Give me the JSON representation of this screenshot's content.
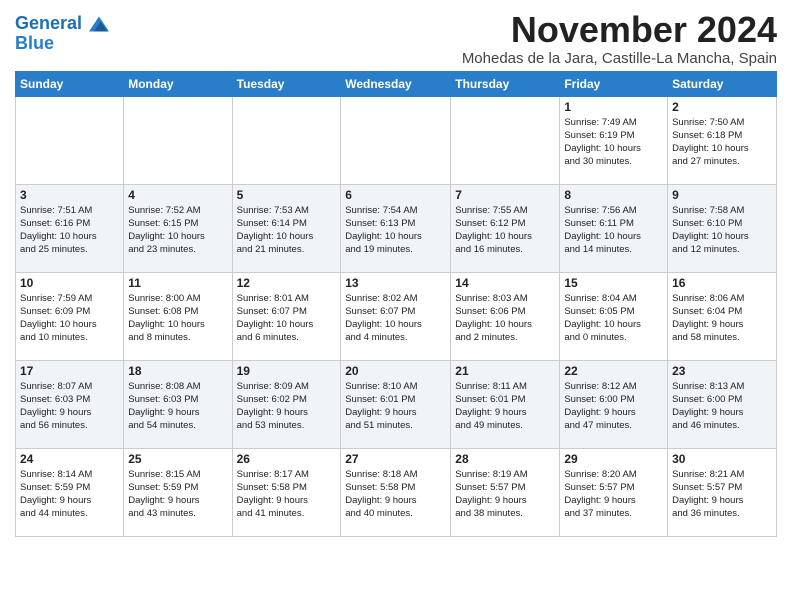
{
  "header": {
    "logo_line1": "General",
    "logo_line2": "Blue",
    "month": "November 2024",
    "location": "Mohedas de la Jara, Castille-La Mancha, Spain"
  },
  "weekdays": [
    "Sunday",
    "Monday",
    "Tuesday",
    "Wednesday",
    "Thursday",
    "Friday",
    "Saturday"
  ],
  "weeks": [
    [
      {
        "day": "",
        "info": ""
      },
      {
        "day": "",
        "info": ""
      },
      {
        "day": "",
        "info": ""
      },
      {
        "day": "",
        "info": ""
      },
      {
        "day": "",
        "info": ""
      },
      {
        "day": "1",
        "info": "Sunrise: 7:49 AM\nSunset: 6:19 PM\nDaylight: 10 hours\nand 30 minutes."
      },
      {
        "day": "2",
        "info": "Sunrise: 7:50 AM\nSunset: 6:18 PM\nDaylight: 10 hours\nand 27 minutes."
      }
    ],
    [
      {
        "day": "3",
        "info": "Sunrise: 7:51 AM\nSunset: 6:16 PM\nDaylight: 10 hours\nand 25 minutes."
      },
      {
        "day": "4",
        "info": "Sunrise: 7:52 AM\nSunset: 6:15 PM\nDaylight: 10 hours\nand 23 minutes."
      },
      {
        "day": "5",
        "info": "Sunrise: 7:53 AM\nSunset: 6:14 PM\nDaylight: 10 hours\nand 21 minutes."
      },
      {
        "day": "6",
        "info": "Sunrise: 7:54 AM\nSunset: 6:13 PM\nDaylight: 10 hours\nand 19 minutes."
      },
      {
        "day": "7",
        "info": "Sunrise: 7:55 AM\nSunset: 6:12 PM\nDaylight: 10 hours\nand 16 minutes."
      },
      {
        "day": "8",
        "info": "Sunrise: 7:56 AM\nSunset: 6:11 PM\nDaylight: 10 hours\nand 14 minutes."
      },
      {
        "day": "9",
        "info": "Sunrise: 7:58 AM\nSunset: 6:10 PM\nDaylight: 10 hours\nand 12 minutes."
      }
    ],
    [
      {
        "day": "10",
        "info": "Sunrise: 7:59 AM\nSunset: 6:09 PM\nDaylight: 10 hours\nand 10 minutes."
      },
      {
        "day": "11",
        "info": "Sunrise: 8:00 AM\nSunset: 6:08 PM\nDaylight: 10 hours\nand 8 minutes."
      },
      {
        "day": "12",
        "info": "Sunrise: 8:01 AM\nSunset: 6:07 PM\nDaylight: 10 hours\nand 6 minutes."
      },
      {
        "day": "13",
        "info": "Sunrise: 8:02 AM\nSunset: 6:07 PM\nDaylight: 10 hours\nand 4 minutes."
      },
      {
        "day": "14",
        "info": "Sunrise: 8:03 AM\nSunset: 6:06 PM\nDaylight: 10 hours\nand 2 minutes."
      },
      {
        "day": "15",
        "info": "Sunrise: 8:04 AM\nSunset: 6:05 PM\nDaylight: 10 hours\nand 0 minutes."
      },
      {
        "day": "16",
        "info": "Sunrise: 8:06 AM\nSunset: 6:04 PM\nDaylight: 9 hours\nand 58 minutes."
      }
    ],
    [
      {
        "day": "17",
        "info": "Sunrise: 8:07 AM\nSunset: 6:03 PM\nDaylight: 9 hours\nand 56 minutes."
      },
      {
        "day": "18",
        "info": "Sunrise: 8:08 AM\nSunset: 6:03 PM\nDaylight: 9 hours\nand 54 minutes."
      },
      {
        "day": "19",
        "info": "Sunrise: 8:09 AM\nSunset: 6:02 PM\nDaylight: 9 hours\nand 53 minutes."
      },
      {
        "day": "20",
        "info": "Sunrise: 8:10 AM\nSunset: 6:01 PM\nDaylight: 9 hours\nand 51 minutes."
      },
      {
        "day": "21",
        "info": "Sunrise: 8:11 AM\nSunset: 6:01 PM\nDaylight: 9 hours\nand 49 minutes."
      },
      {
        "day": "22",
        "info": "Sunrise: 8:12 AM\nSunset: 6:00 PM\nDaylight: 9 hours\nand 47 minutes."
      },
      {
        "day": "23",
        "info": "Sunrise: 8:13 AM\nSunset: 6:00 PM\nDaylight: 9 hours\nand 46 minutes."
      }
    ],
    [
      {
        "day": "24",
        "info": "Sunrise: 8:14 AM\nSunset: 5:59 PM\nDaylight: 9 hours\nand 44 minutes."
      },
      {
        "day": "25",
        "info": "Sunrise: 8:15 AM\nSunset: 5:59 PM\nDaylight: 9 hours\nand 43 minutes."
      },
      {
        "day": "26",
        "info": "Sunrise: 8:17 AM\nSunset: 5:58 PM\nDaylight: 9 hours\nand 41 minutes."
      },
      {
        "day": "27",
        "info": "Sunrise: 8:18 AM\nSunset: 5:58 PM\nDaylight: 9 hours\nand 40 minutes."
      },
      {
        "day": "28",
        "info": "Sunrise: 8:19 AM\nSunset: 5:57 PM\nDaylight: 9 hours\nand 38 minutes."
      },
      {
        "day": "29",
        "info": "Sunrise: 8:20 AM\nSunset: 5:57 PM\nDaylight: 9 hours\nand 37 minutes."
      },
      {
        "day": "30",
        "info": "Sunrise: 8:21 AM\nSunset: 5:57 PM\nDaylight: 9 hours\nand 36 minutes."
      }
    ]
  ]
}
